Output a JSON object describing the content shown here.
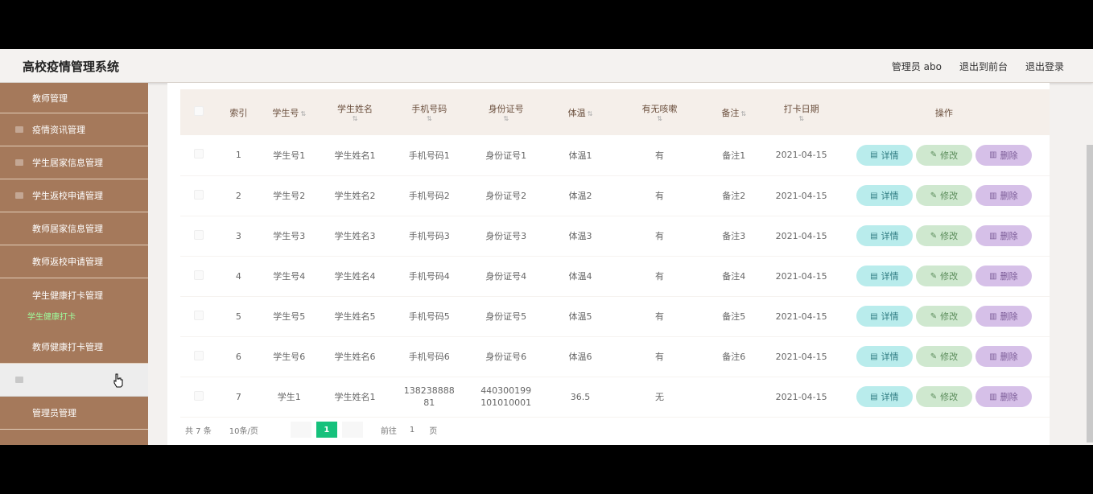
{
  "app": {
    "title": "高校疫情管理系统"
  },
  "topnav": {
    "user": "管理员 abo",
    "front": "退出到前台",
    "logout": "退出登录"
  },
  "sidebar": {
    "items": [
      {
        "label": "教师管理"
      },
      {
        "label": "疫情资讯管理"
      },
      {
        "label": "学生居家信息管理"
      },
      {
        "label": "学生返校申请管理"
      },
      {
        "label": "教师居家信息管理"
      },
      {
        "label": "教师返校申请管理"
      },
      {
        "label": "学生健康打卡管理"
      },
      {
        "label": "教师健康打卡管理"
      },
      {
        "label": ""
      },
      {
        "label": "管理员管理"
      }
    ],
    "sub": "学生健康打卡"
  },
  "table": {
    "columns": [
      "索引",
      "学生号",
      "学生姓名",
      "手机号码",
      "身份证号",
      "体温",
      "有无咳嗽",
      "备注",
      "打卡日期",
      "操作"
    ],
    "buttons": {
      "detail": "详情",
      "edit": "修改",
      "delete": "删除"
    },
    "rows": [
      {
        "idx": "1",
        "sno": "学生号1",
        "name": "学生姓名1",
        "phone": "手机号码1",
        "idcard": "身份证号1",
        "temp": "体温1",
        "cough": "有",
        "note": "备注1",
        "date": "2021-04-15"
      },
      {
        "idx": "2",
        "sno": "学生号2",
        "name": "学生姓名2",
        "phone": "手机号码2",
        "idcard": "身份证号2",
        "temp": "体温2",
        "cough": "有",
        "note": "备注2",
        "date": "2021-04-15"
      },
      {
        "idx": "3",
        "sno": "学生号3",
        "name": "学生姓名3",
        "phone": "手机号码3",
        "idcard": "身份证号3",
        "temp": "体温3",
        "cough": "有",
        "note": "备注3",
        "date": "2021-04-15"
      },
      {
        "idx": "4",
        "sno": "学生号4",
        "name": "学生姓名4",
        "phone": "手机号码4",
        "idcard": "身份证号4",
        "temp": "体温4",
        "cough": "有",
        "note": "备注4",
        "date": "2021-04-15"
      },
      {
        "idx": "5",
        "sno": "学生号5",
        "name": "学生姓名5",
        "phone": "手机号码5",
        "idcard": "身份证号5",
        "temp": "体温5",
        "cough": "有",
        "note": "备注5",
        "date": "2021-04-15"
      },
      {
        "idx": "6",
        "sno": "学生号6",
        "name": "学生姓名6",
        "phone": "手机号码6",
        "idcard": "身份证号6",
        "temp": "体温6",
        "cough": "有",
        "note": "备注6",
        "date": "2021-04-15"
      },
      {
        "idx": "7",
        "sno": "学生1",
        "name": "学生姓名1",
        "phone": "13823888881",
        "phone_l1": "138238888",
        "phone_l2": "81",
        "idcard": "440300199101010001",
        "id_l1": "440300199",
        "id_l2": "101010001",
        "temp": "36.5",
        "cough": "无",
        "note": "",
        "date": "2021-04-15"
      }
    ]
  },
  "pager": {
    "total": "共 7 条",
    "size": "10条/页",
    "current": "1",
    "goto": "前往",
    "goto_value": "1",
    "page_unit": "页"
  }
}
